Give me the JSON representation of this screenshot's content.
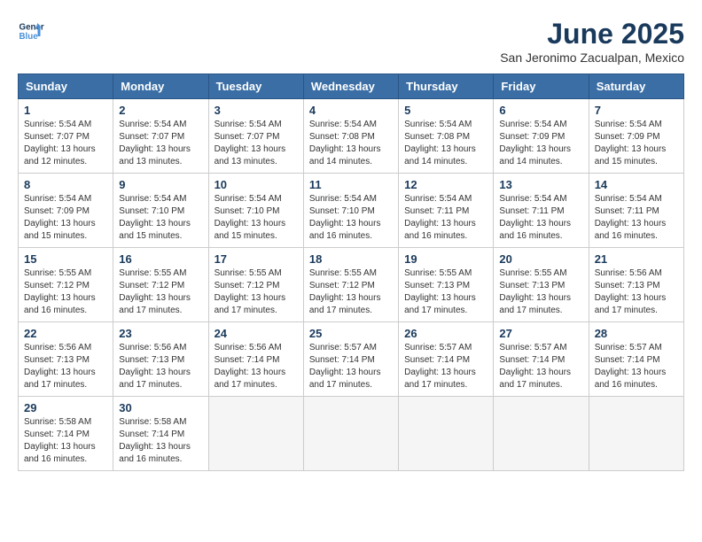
{
  "logo": {
    "line1": "General",
    "line2": "Blue"
  },
  "title": "June 2025",
  "location": "San Jeronimo Zacualpan, Mexico",
  "headers": [
    "Sunday",
    "Monday",
    "Tuesday",
    "Wednesday",
    "Thursday",
    "Friday",
    "Saturday"
  ],
  "weeks": [
    [
      {
        "day": "1",
        "sunrise": "5:54 AM",
        "sunset": "7:07 PM",
        "daylight": "13 hours and 12 minutes."
      },
      {
        "day": "2",
        "sunrise": "5:54 AM",
        "sunset": "7:07 PM",
        "daylight": "13 hours and 13 minutes."
      },
      {
        "day": "3",
        "sunrise": "5:54 AM",
        "sunset": "7:07 PM",
        "daylight": "13 hours and 13 minutes."
      },
      {
        "day": "4",
        "sunrise": "5:54 AM",
        "sunset": "7:08 PM",
        "daylight": "13 hours and 14 minutes."
      },
      {
        "day": "5",
        "sunrise": "5:54 AM",
        "sunset": "7:08 PM",
        "daylight": "13 hours and 14 minutes."
      },
      {
        "day": "6",
        "sunrise": "5:54 AM",
        "sunset": "7:09 PM",
        "daylight": "13 hours and 14 minutes."
      },
      {
        "day": "7",
        "sunrise": "5:54 AM",
        "sunset": "7:09 PM",
        "daylight": "13 hours and 15 minutes."
      }
    ],
    [
      {
        "day": "8",
        "sunrise": "5:54 AM",
        "sunset": "7:09 PM",
        "daylight": "13 hours and 15 minutes."
      },
      {
        "day": "9",
        "sunrise": "5:54 AM",
        "sunset": "7:10 PM",
        "daylight": "13 hours and 15 minutes."
      },
      {
        "day": "10",
        "sunrise": "5:54 AM",
        "sunset": "7:10 PM",
        "daylight": "13 hours and 15 minutes."
      },
      {
        "day": "11",
        "sunrise": "5:54 AM",
        "sunset": "7:10 PM",
        "daylight": "13 hours and 16 minutes."
      },
      {
        "day": "12",
        "sunrise": "5:54 AM",
        "sunset": "7:11 PM",
        "daylight": "13 hours and 16 minutes."
      },
      {
        "day": "13",
        "sunrise": "5:54 AM",
        "sunset": "7:11 PM",
        "daylight": "13 hours and 16 minutes."
      },
      {
        "day": "14",
        "sunrise": "5:54 AM",
        "sunset": "7:11 PM",
        "daylight": "13 hours and 16 minutes."
      }
    ],
    [
      {
        "day": "15",
        "sunrise": "5:55 AM",
        "sunset": "7:12 PM",
        "daylight": "13 hours and 16 minutes."
      },
      {
        "day": "16",
        "sunrise": "5:55 AM",
        "sunset": "7:12 PM",
        "daylight": "13 hours and 17 minutes."
      },
      {
        "day": "17",
        "sunrise": "5:55 AM",
        "sunset": "7:12 PM",
        "daylight": "13 hours and 17 minutes."
      },
      {
        "day": "18",
        "sunrise": "5:55 AM",
        "sunset": "7:12 PM",
        "daylight": "13 hours and 17 minutes."
      },
      {
        "day": "19",
        "sunrise": "5:55 AM",
        "sunset": "7:13 PM",
        "daylight": "13 hours and 17 minutes."
      },
      {
        "day": "20",
        "sunrise": "5:55 AM",
        "sunset": "7:13 PM",
        "daylight": "13 hours and 17 minutes."
      },
      {
        "day": "21",
        "sunrise": "5:56 AM",
        "sunset": "7:13 PM",
        "daylight": "13 hours and 17 minutes."
      }
    ],
    [
      {
        "day": "22",
        "sunrise": "5:56 AM",
        "sunset": "7:13 PM",
        "daylight": "13 hours and 17 minutes."
      },
      {
        "day": "23",
        "sunrise": "5:56 AM",
        "sunset": "7:13 PM",
        "daylight": "13 hours and 17 minutes."
      },
      {
        "day": "24",
        "sunrise": "5:56 AM",
        "sunset": "7:14 PM",
        "daylight": "13 hours and 17 minutes."
      },
      {
        "day": "25",
        "sunrise": "5:57 AM",
        "sunset": "7:14 PM",
        "daylight": "13 hours and 17 minutes."
      },
      {
        "day": "26",
        "sunrise": "5:57 AM",
        "sunset": "7:14 PM",
        "daylight": "13 hours and 17 minutes."
      },
      {
        "day": "27",
        "sunrise": "5:57 AM",
        "sunset": "7:14 PM",
        "daylight": "13 hours and 17 minutes."
      },
      {
        "day": "28",
        "sunrise": "5:57 AM",
        "sunset": "7:14 PM",
        "daylight": "13 hours and 16 minutes."
      }
    ],
    [
      {
        "day": "29",
        "sunrise": "5:58 AM",
        "sunset": "7:14 PM",
        "daylight": "13 hours and 16 minutes."
      },
      {
        "day": "30",
        "sunrise": "5:58 AM",
        "sunset": "7:14 PM",
        "daylight": "13 hours and 16 minutes."
      },
      null,
      null,
      null,
      null,
      null
    ]
  ]
}
